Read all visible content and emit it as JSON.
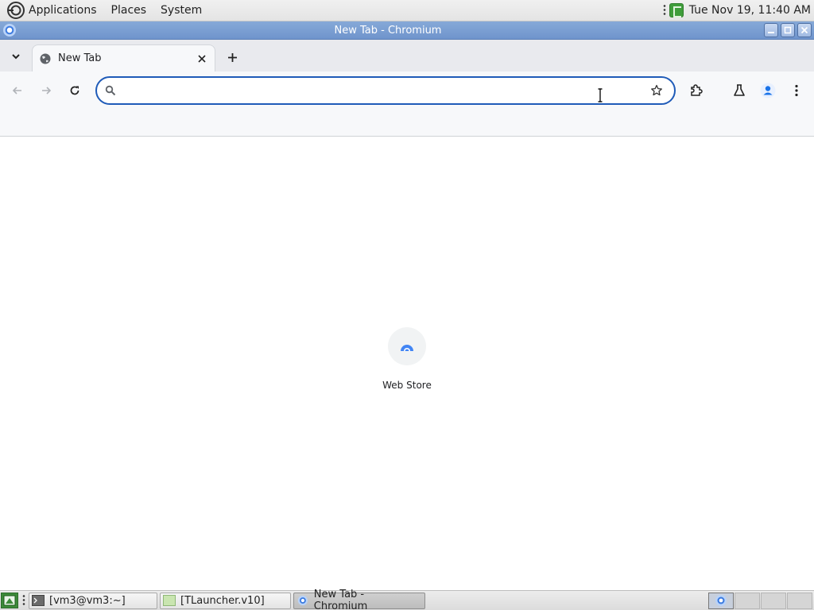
{
  "top_panel": {
    "menus": [
      "Applications",
      "Places",
      "System"
    ],
    "clock": "Tue Nov 19, 11:40 AM"
  },
  "window": {
    "title": "New Tab - Chromium"
  },
  "tabs": [
    {
      "title": "New Tab",
      "active": true
    }
  ],
  "toolbar": {
    "omnibox_value": "",
    "omnibox_placeholder": ""
  },
  "content": {
    "shortcuts": [
      {
        "label": "Web Store"
      }
    ]
  },
  "taskbar": {
    "tasks": [
      {
        "label": "[vm3@vm3:~]",
        "icon": "terminal-icon",
        "active": false
      },
      {
        "label": "[TLauncher.v10]",
        "icon": "folder-icon",
        "active": false
      },
      {
        "label": "New Tab - Chromium",
        "icon": "chromium-icon",
        "active": true
      }
    ]
  },
  "colors": {
    "accent": "#1f5bb8",
    "titlebar": "#7a9fd4",
    "tabstrip": "#e9eaee",
    "toolbar": "#f7f8fa",
    "profile": "#1a73e8"
  }
}
